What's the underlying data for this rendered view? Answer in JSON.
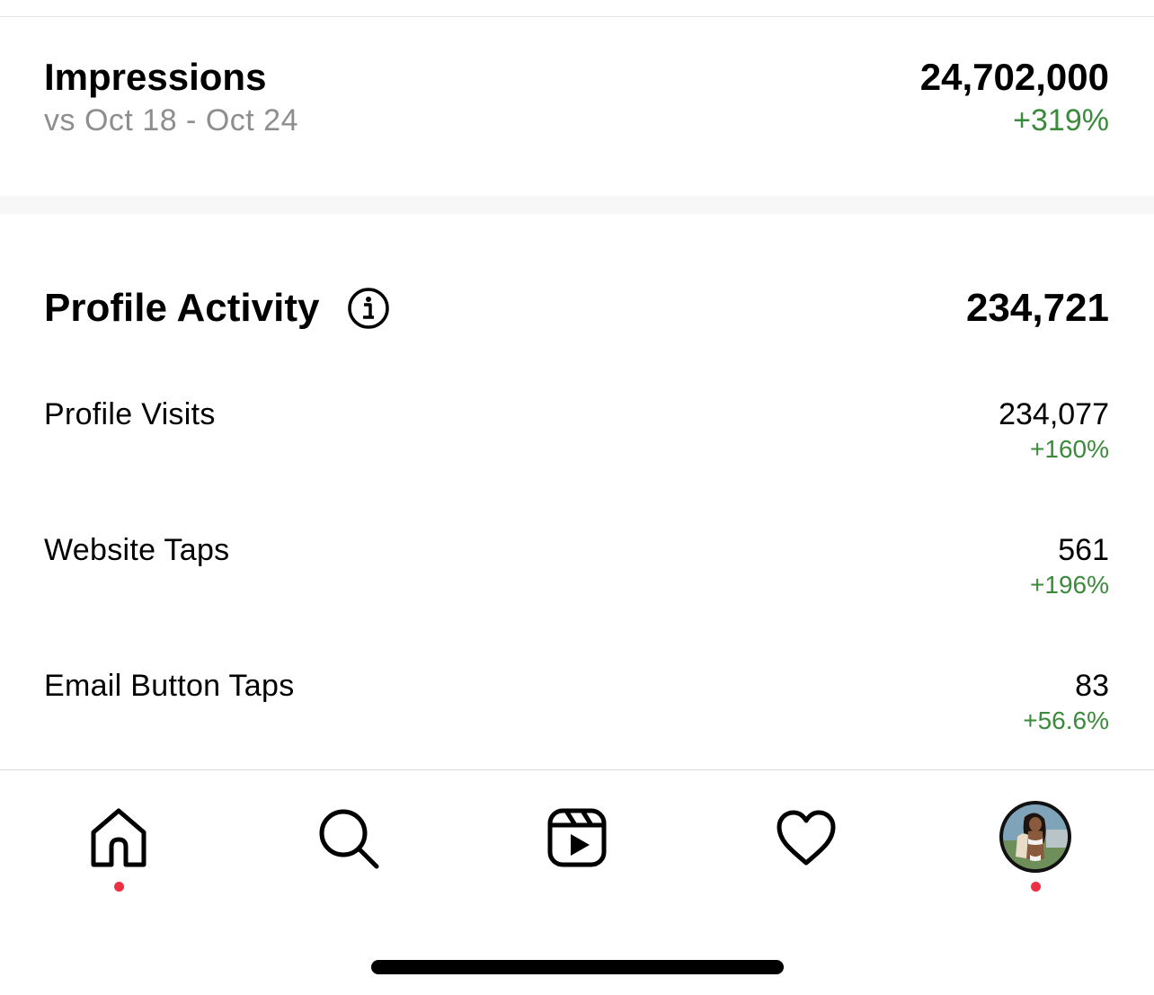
{
  "impressions": {
    "title": "Impressions",
    "comparison": "vs Oct 18 - Oct 24",
    "value": "24,702,000",
    "change": "+319%"
  },
  "profile_activity": {
    "title": "Profile Activity",
    "info_icon": "info-icon",
    "total": "234,721",
    "rows": [
      {
        "label": "Profile Visits",
        "value": "234,077",
        "change": "+160%"
      },
      {
        "label": "Website Taps",
        "value": "561",
        "change": "+196%"
      },
      {
        "label": "Email Button Taps",
        "value": "83",
        "change": "+56.6%"
      }
    ]
  },
  "tab_bar": {
    "items": [
      {
        "icon": "home-icon",
        "has_dot": true
      },
      {
        "icon": "search-icon",
        "has_dot": false
      },
      {
        "icon": "reels-icon",
        "has_dot": false
      },
      {
        "icon": "heart-icon",
        "has_dot": false
      },
      {
        "icon": "profile-avatar",
        "has_dot": true
      }
    ]
  },
  "colors": {
    "positive_change": "#3c8a3c",
    "secondary_text": "#8e8e8e",
    "notification_dot": "#ed3145"
  }
}
